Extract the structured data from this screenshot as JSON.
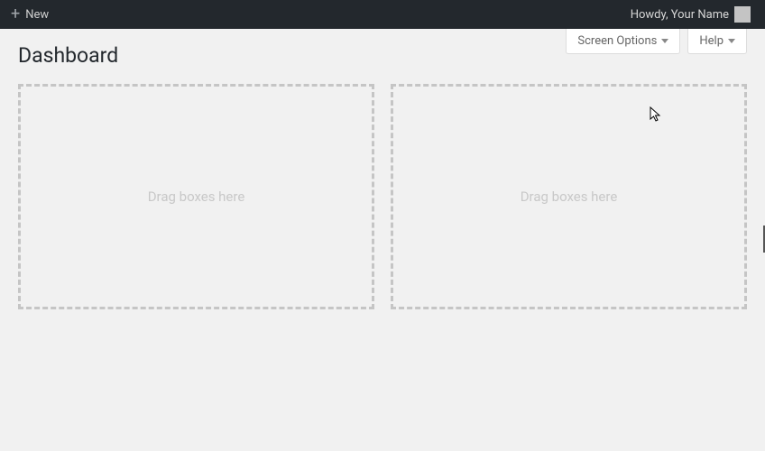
{
  "adminbar": {
    "new_label": "New",
    "howdy_text": "Howdy, Your Name"
  },
  "screen_meta": {
    "screen_options_label": "Screen Options",
    "help_label": "Help"
  },
  "page": {
    "title": "Dashboard"
  },
  "dropzones": {
    "left_text": "Drag boxes here",
    "right_text": "Drag boxes here"
  }
}
